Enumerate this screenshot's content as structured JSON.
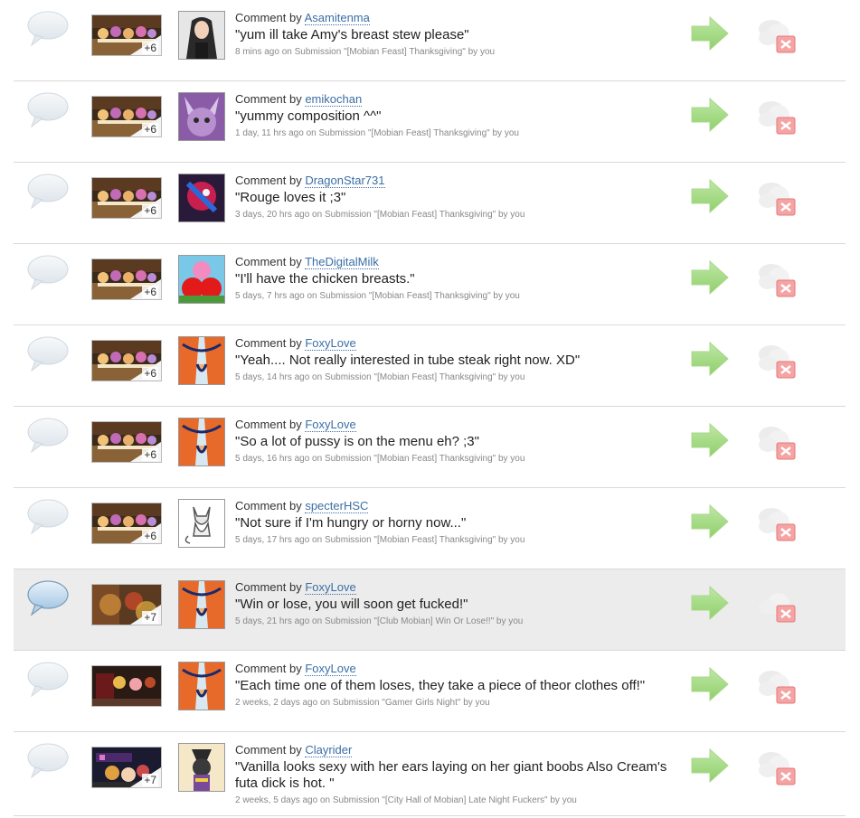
{
  "comment_prefix": "Comment by",
  "comments": [
    {
      "user": "Asamitenma",
      "text": "\"yum ill take Amy's breast stew please\"",
      "meta": "8 mins ago on Submission \"[Mobian Feast] Thanksgiving\" by you",
      "plus": "+6",
      "thumb": "feast",
      "avatar": "a1"
    },
    {
      "user": "emikochan",
      "text": "\"yummy composition ^^\"",
      "meta": "1 day, 11 hrs ago on Submission \"[Mobian Feast] Thanksgiving\" by you",
      "plus": "+6",
      "thumb": "feast",
      "avatar": "a2"
    },
    {
      "user": "DragonStar731",
      "text": "\"Rouge loves it ;3\"",
      "meta": "3 days, 20 hrs ago on Submission \"[Mobian Feast] Thanksgiving\" by you",
      "plus": "+6",
      "thumb": "feast",
      "avatar": "a3"
    },
    {
      "user": "TheDigitalMilk",
      "text": "\"I'll have the chicken breasts.\"",
      "meta": "5 days, 7 hrs ago on Submission \"[Mobian Feast] Thanksgiving\" by you",
      "plus": "+6",
      "thumb": "feast",
      "avatar": "a4"
    },
    {
      "user": "FoxyLove",
      "text": "\"Yeah.... Not really interested in tube steak right now. XD\"",
      "meta": "5 days, 14 hrs ago on Submission \"[Mobian Feast] Thanksgiving\" by you",
      "plus": "+6",
      "thumb": "feast",
      "avatar": "a5"
    },
    {
      "user": "FoxyLove",
      "text": "\"So a lot of pussy is on the menu eh? ;3\"",
      "meta": "5 days, 16 hrs ago on Submission \"[Mobian Feast] Thanksgiving\" by you",
      "plus": "+6",
      "thumb": "feast",
      "avatar": "a5"
    },
    {
      "user": "specterHSC",
      "text": "\"Not sure if I'm hungry or horny now...\"",
      "meta": "5 days, 17 hrs ago on Submission \"[Mobian Feast] Thanksgiving\" by you",
      "plus": "+6",
      "thumb": "feast",
      "avatar": "a6"
    },
    {
      "user": "FoxyLove",
      "text": "\"Win or lose, you will soon get fucked!\"",
      "meta": "5 days, 21 hrs ago on Submission \"[Club Mobian] Win Or Lose!!\" by you",
      "plus": "+7",
      "thumb": "club",
      "avatar": "a5",
      "highlight": true
    },
    {
      "user": "FoxyLove",
      "text": "\"Each time one of them loses, they take a piece of theor clothes off!\"",
      "meta": "2 weeks, 2 days ago on Submission \"Gamer Girls Night\" by you",
      "plus": "",
      "thumb": "gamer",
      "avatar": "a5"
    },
    {
      "user": "Clayrider",
      "text": "\"Vanilla looks sexy with her ears laying on her giant boobs Also Cream's futa dick is hot. \"",
      "meta": "2 weeks, 5 days ago on Submission \"[City Hall of Mobian] Late Night Fuckers\" by you",
      "plus": "+7",
      "thumb": "city",
      "avatar": "a7"
    }
  ],
  "icons": {
    "bubble": "speech-bubble-icon",
    "arrow": "green-arrow-icon",
    "delete": "delete-icon"
  }
}
